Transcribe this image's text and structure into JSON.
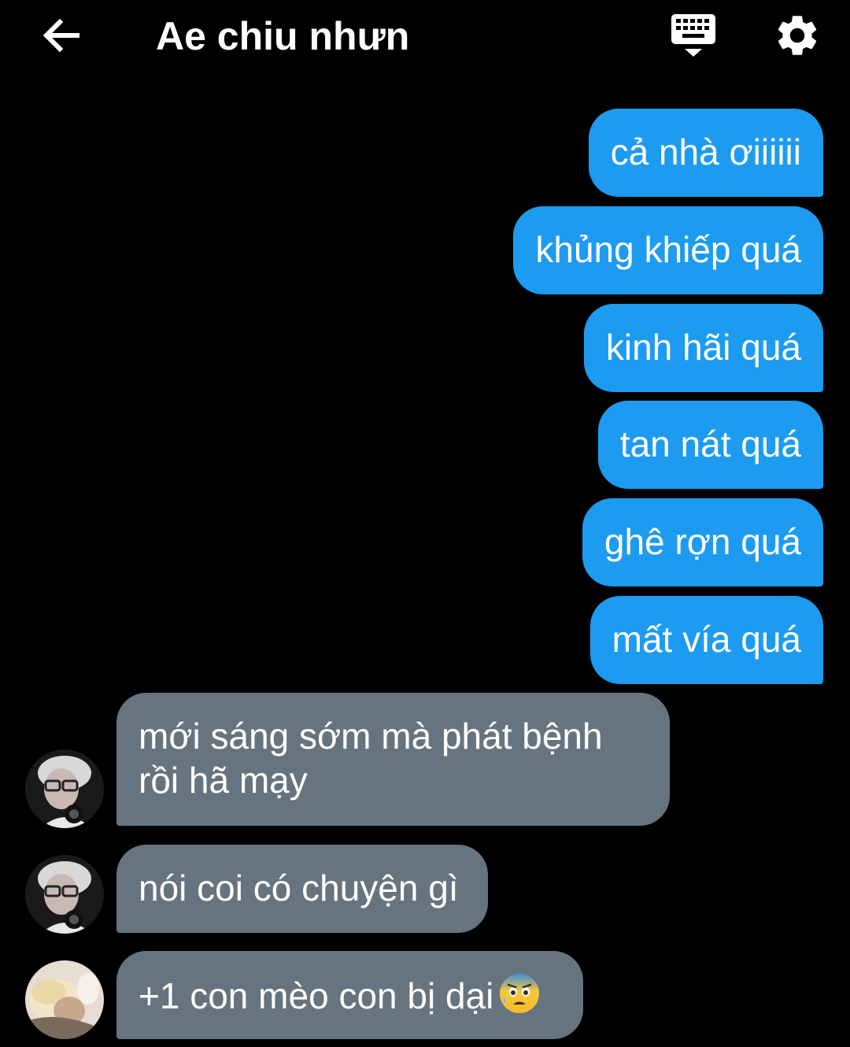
{
  "header": {
    "title": "Ae chiu nhưn",
    "back_icon": "arrow-left-icon",
    "keyboard_icon": "keyboard-hide-icon",
    "settings_icon": "gear-icon"
  },
  "colors": {
    "background": "#000000",
    "outgoing_bubble": "#1d9bf0",
    "incoming_bubble": "#66747f",
    "text": "#ffffff"
  },
  "messages": [
    {
      "direction": "outgoing",
      "text": "cả nhà ơiiiiii"
    },
    {
      "direction": "outgoing",
      "text": "khủng khiếp quá"
    },
    {
      "direction": "outgoing",
      "text": "kinh hãi quá"
    },
    {
      "direction": "outgoing",
      "text": "tan nát quá"
    },
    {
      "direction": "outgoing",
      "text": "ghê rợn quá"
    },
    {
      "direction": "outgoing",
      "text": "mất vía quá"
    },
    {
      "direction": "incoming",
      "line1": "mới sáng sớm mà phát bệnh",
      "line2": "rồi hã mạy",
      "avatar": "avatar-glasses"
    },
    {
      "direction": "incoming",
      "text": "nói coi có chuyện gì",
      "avatar": "avatar-glasses"
    },
    {
      "direction": "incoming",
      "text": "+1 con mèo con bị dại",
      "emoji": "anxious-face-icon",
      "avatar": "avatar-blonde"
    }
  ]
}
